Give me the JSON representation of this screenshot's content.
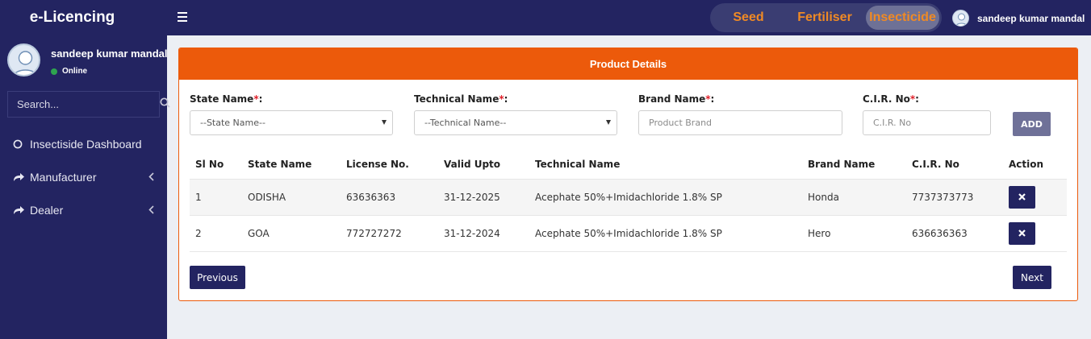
{
  "app": {
    "brand": "e-Licencing"
  },
  "user": {
    "name": "sandeep kumar mandal",
    "status": "Online"
  },
  "search": {
    "placeholder": "Search..."
  },
  "sidebar": {
    "items": [
      {
        "label": "Insectiside Dashboard",
        "icon": "circle-outline-icon"
      },
      {
        "label": "Manufacturer",
        "icon": "share-arrow-icon"
      },
      {
        "label": "Dealer",
        "icon": "share-arrow-icon"
      }
    ]
  },
  "topbar": {
    "modules": [
      "Seed",
      "Fertiliser",
      "Insecticide"
    ],
    "active_module": "Insecticide",
    "accent_color": "#f08a24"
  },
  "card": {
    "title": "Product Details",
    "header_color": "#ec5a0b"
  },
  "form": {
    "state": {
      "label": "State Name",
      "value": "--State Name--"
    },
    "technical": {
      "label": "Technical Name",
      "value": "--Technical Name--"
    },
    "brand": {
      "label": "Brand Name",
      "placeholder": "Product Brand"
    },
    "cir": {
      "label": "C.I.R. No",
      "placeholder": "C.I.R. No"
    },
    "required_mark": "*",
    "label_suffix": ":",
    "add_label": "ADD"
  },
  "table": {
    "headers": [
      "Sl No",
      "State Name",
      "License No.",
      "Valid Upto",
      "Technical Name",
      "Brand Name",
      "C.I.R. No",
      "Action"
    ],
    "rows": [
      [
        "1",
        "ODISHA",
        "63636363",
        "31-12-2025",
        "Acephate 50%+Imidachloride 1.8% SP",
        "Honda",
        "7737373773"
      ],
      [
        "2",
        "GOA",
        "772727272",
        "31-12-2024",
        "Acephate 50%+Imidachloride 1.8% SP",
        "Hero",
        "636636363"
      ]
    ]
  },
  "pagination": {
    "previous": "Previous",
    "next": "Next"
  }
}
